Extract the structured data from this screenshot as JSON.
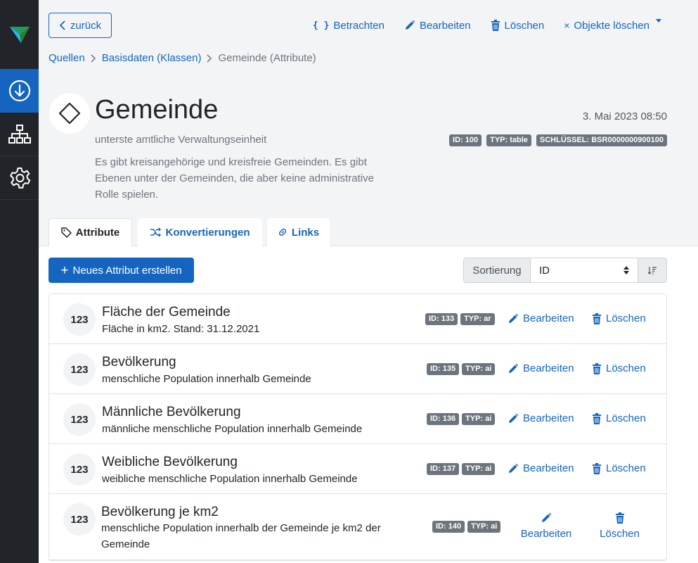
{
  "colors": {
    "accent": "#1565c0",
    "sidebar": "#212529",
    "badge": "#6c757d"
  },
  "sidebar": {
    "logo_icon": "triangle-logo-icon",
    "items": [
      {
        "icon": "download-circle-icon",
        "active": true
      },
      {
        "icon": "sitemap-icon",
        "active": false
      },
      {
        "icon": "gear-icon",
        "active": false
      }
    ]
  },
  "toolbar": {
    "back_label": "zurück",
    "view_label": "Betrachten",
    "view_icon": "{ }",
    "edit_label": "Bearbeiten",
    "delete_label": "Löschen",
    "delete_objects_label": "Objekte löschen"
  },
  "breadcrumb": {
    "items": [
      "Quellen",
      "Basisdaten (Klassen)",
      "Gemeinde (Attribute)"
    ]
  },
  "header": {
    "title": "Gemeinde",
    "subtitle": "unterste amtliche Verwaltungseinheit",
    "description": "Es gibt kreisangehörige und kreisfreie Gemeinden. Es gibt Ebenen unter der Gemeinden, die aber keine administrative Rolle spielen.",
    "date": "3. Mai 2023 08:50",
    "badges": [
      "ID: 100",
      "TYP: table",
      "SCHLÜSSEL: BSR0000000900100"
    ]
  },
  "tabs": [
    {
      "label": "Attribute",
      "icon": "tag-icon",
      "active": true
    },
    {
      "label": "Konvertierungen",
      "icon": "shuffle-icon",
      "active": false
    },
    {
      "label": "Links",
      "icon": "link-icon",
      "active": false
    }
  ],
  "actions": {
    "new_label": "Neues Attribut erstellen",
    "sort_label": "Sortierung",
    "sort_value": "ID"
  },
  "attributes": [
    {
      "icon_text": "123",
      "name": "Fläche der Gemeinde",
      "desc": "Fläche in km2. Stand: 31.12.2021",
      "id": "ID: 133",
      "type": "TYP: ar",
      "edit": "Bearbeiten",
      "delete": "Löschen"
    },
    {
      "icon_text": "123",
      "name": "Bevölkerung",
      "desc": "menschliche Population innerhalb Gemeinde",
      "id": "ID: 135",
      "type": "TYP: ai",
      "edit": "Bearbeiten",
      "delete": "Löschen"
    },
    {
      "icon_text": "123",
      "name": "Männliche Bevölkerung",
      "desc": "männliche menschliche Population innerhalb Gemeinde",
      "id": "ID: 136",
      "type": "TYP: ai",
      "edit": "Bearbeiten",
      "delete": "Löschen"
    },
    {
      "icon_text": "123",
      "name": "Weibliche Bevölkerung",
      "desc": "weibliche menschliche Population innerhalb Gemeinde",
      "id": "ID: 137",
      "type": "TYP: ai",
      "edit": "Bearbeiten",
      "delete": "Löschen"
    },
    {
      "icon_text": "123",
      "name": "Bevölkerung je km2",
      "desc": "menschliche Population innerhalb der Gemeinde je km2 der Gemeinde",
      "id": "ID: 140",
      "type": "TYP: ai",
      "edit": "Bearbeiten",
      "delete": "Löschen"
    }
  ]
}
